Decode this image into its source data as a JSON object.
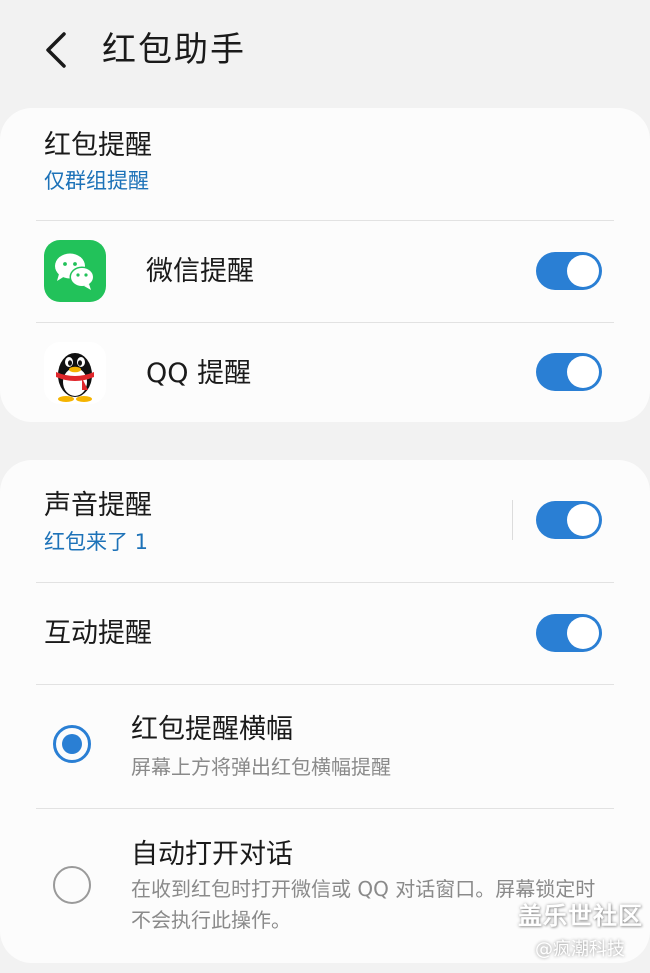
{
  "header": {
    "title": "红包助手",
    "back_icon": "chevron-left-icon"
  },
  "card1": {
    "title": "红包提醒",
    "subtitle": "仅群组提醒",
    "apps": [
      {
        "label": "微信提醒",
        "icon": "wechat-icon",
        "enabled": true
      },
      {
        "label": "QQ 提醒",
        "icon": "qq-icon",
        "enabled": true
      }
    ]
  },
  "card2": {
    "sound": {
      "title": "声音提醒",
      "subtitle": "红包来了 1",
      "enabled": true
    },
    "interactive": {
      "title": "互动提醒",
      "enabled": true
    },
    "options": [
      {
        "title": "红包提醒横幅",
        "desc": "屏幕上方将弹出红包横幅提醒",
        "selected": true
      },
      {
        "title": "自动打开对话",
        "desc": "在收到红包时打开微信或 QQ 对话窗口。屏幕锁定时不会执行此操作。",
        "selected": false
      }
    ]
  },
  "watermark": {
    "brand": "盖乐世社区",
    "author": "@疯潮科技"
  },
  "colors": {
    "accent": "#2a7fd4",
    "link": "#1d72b8",
    "wechat_green": "#22c25a",
    "background": "#f2f2f2",
    "card": "#fcfcfc"
  }
}
